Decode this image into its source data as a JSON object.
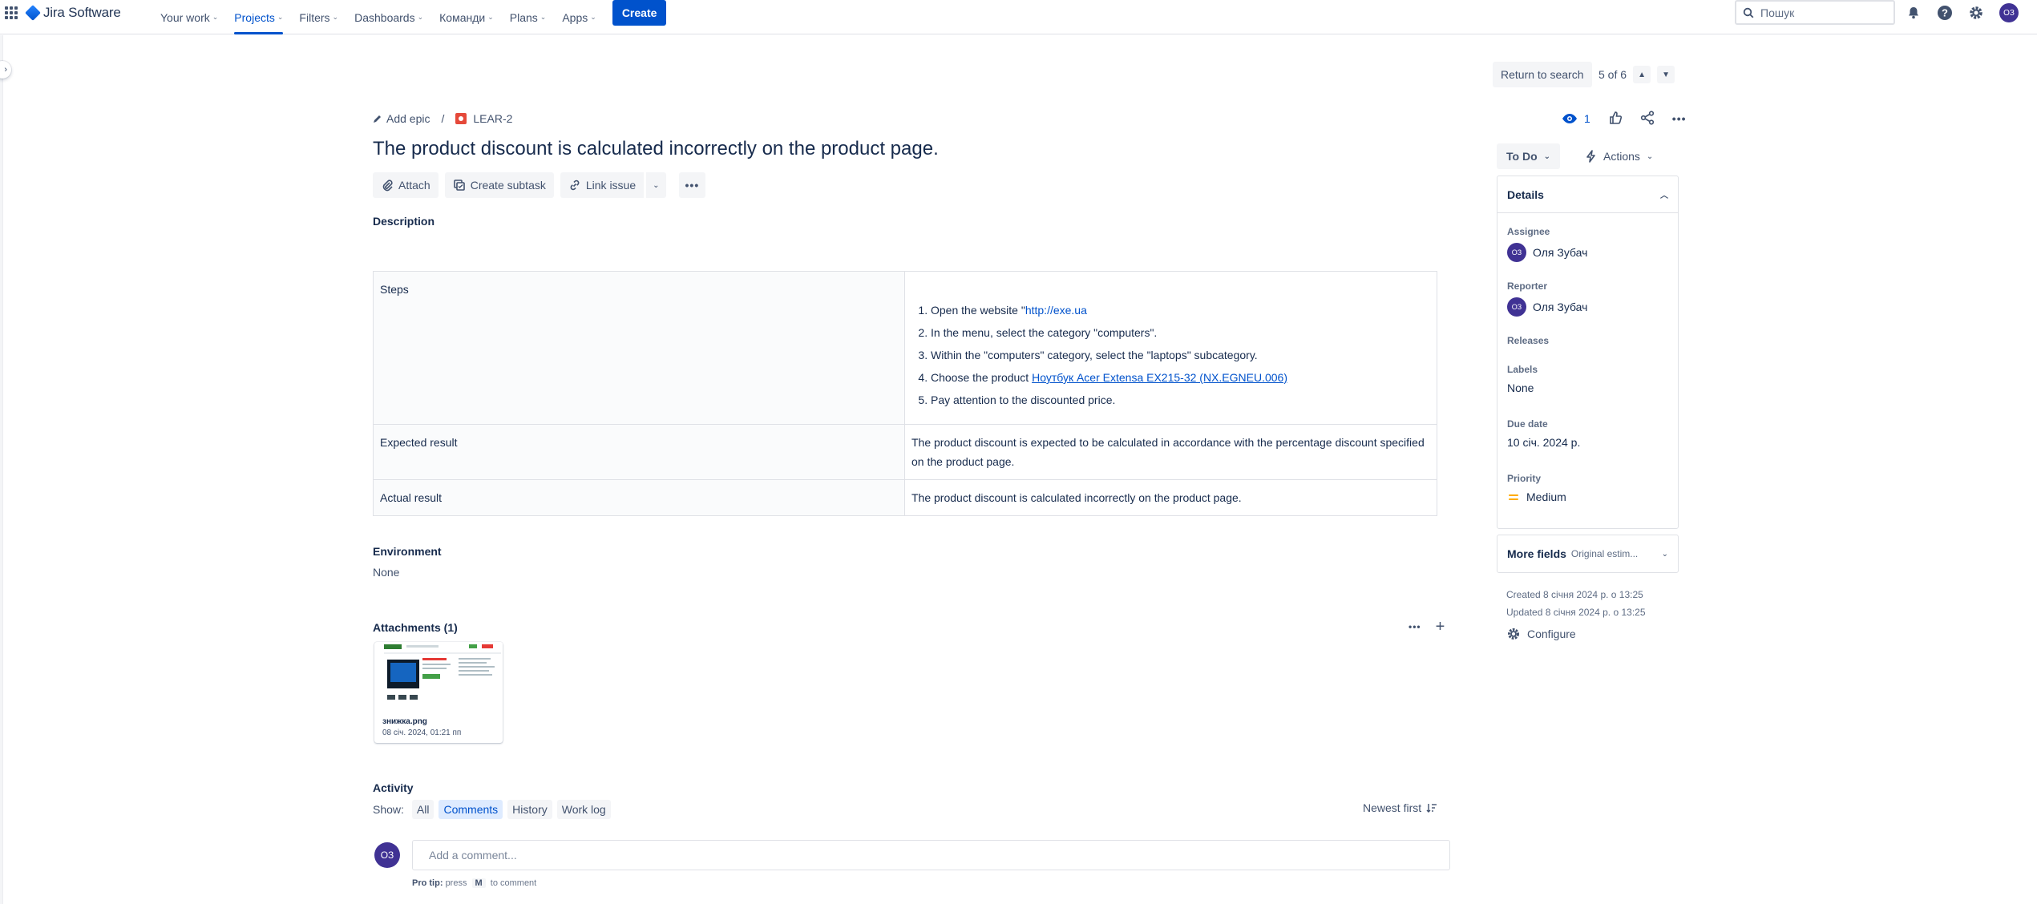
{
  "nav": {
    "brand": "Jira Software",
    "items": [
      {
        "label": "Your work"
      },
      {
        "label": "Projects",
        "active": true
      },
      {
        "label": "Filters"
      },
      {
        "label": "Dashboards"
      },
      {
        "label": "Команди"
      },
      {
        "label": "Plans"
      },
      {
        "label": "Apps"
      }
    ],
    "create_label": "Create",
    "search_placeholder": "Пошук",
    "user_initials": "ОЗ"
  },
  "issue_nav": {
    "return_label": "Return to search",
    "position": "5 of 6"
  },
  "breadcrumb": {
    "add_epic": "Add epic",
    "separator": "/",
    "issue_key": "LEAR-2"
  },
  "issue": {
    "title": "The product discount is calculated incorrectly on the product page.",
    "toolbar": {
      "attach": "Attach",
      "create_subtask": "Create subtask",
      "link_issue": "Link issue"
    },
    "description_label": "Description",
    "table": {
      "steps_label": "Steps",
      "steps": [
        {
          "text": "Open the website \"",
          "link": "http://exe.ua"
        },
        {
          "text": "In the menu, select the category \"computers\"."
        },
        {
          "text": "Within the \"computers\" category, select the \"laptops\" subcategory."
        },
        {
          "text": "Choose the product ",
          "link": "Ноутбук Acer Extensa EX215-32 (NX.EGNEU.006)"
        },
        {
          "text": "Pay attention to the discounted price."
        }
      ],
      "expected_label": "Expected result",
      "expected_value": "The product discount is expected to be calculated in accordance with the percentage discount specified on the product page.",
      "actual_label": "Actual result",
      "actual_value": "The product discount is calculated incorrectly on the product page."
    },
    "environment_label": "Environment",
    "environment_value": "None",
    "attachments_label": "Attachments (1)",
    "attachment": {
      "name": "знижка.png",
      "date": "08 січ. 2024, 01:21 пп"
    },
    "activity": {
      "label": "Activity",
      "show_label": "Show:",
      "filters": [
        {
          "label": "All"
        },
        {
          "label": "Comments",
          "active": true
        },
        {
          "label": "History"
        },
        {
          "label": "Work log"
        }
      ],
      "sort_label": "Newest first",
      "comment_placeholder": "Add a comment...",
      "avatar": "ОЗ",
      "protip_prefix": "Pro tip:",
      "protip_press": "press",
      "protip_key": "M",
      "protip_suffix": "to comment"
    }
  },
  "sidebar_panel": {
    "watch_count": "1",
    "status": "To Do",
    "actions_label": "Actions",
    "details_label": "Details",
    "fields": {
      "assignee_label": "Assignee",
      "assignee_value": "Оля Зубач",
      "assignee_initials": "ОЗ",
      "reporter_label": "Reporter",
      "reporter_value": "Оля Зубач",
      "reporter_initials": "ОЗ",
      "releases_label": "Releases",
      "labels_label": "Labels",
      "labels_value": "None",
      "due_label": "Due date",
      "due_value": "10 січ. 2024 р.",
      "priority_label": "Priority",
      "priority_value": "Medium"
    },
    "more_fields_label": "More fields",
    "more_fields_sub": "Original estim...",
    "created": "Created 8 січня 2024 р. о 13:25",
    "updated": "Updated 8 січня 2024 р. о 13:25",
    "configure": "Configure"
  },
  "colors": {
    "accent": "#0052cc",
    "bug": "#e5493a",
    "priority_medium": "#ffab00",
    "avatar": "#403294"
  }
}
